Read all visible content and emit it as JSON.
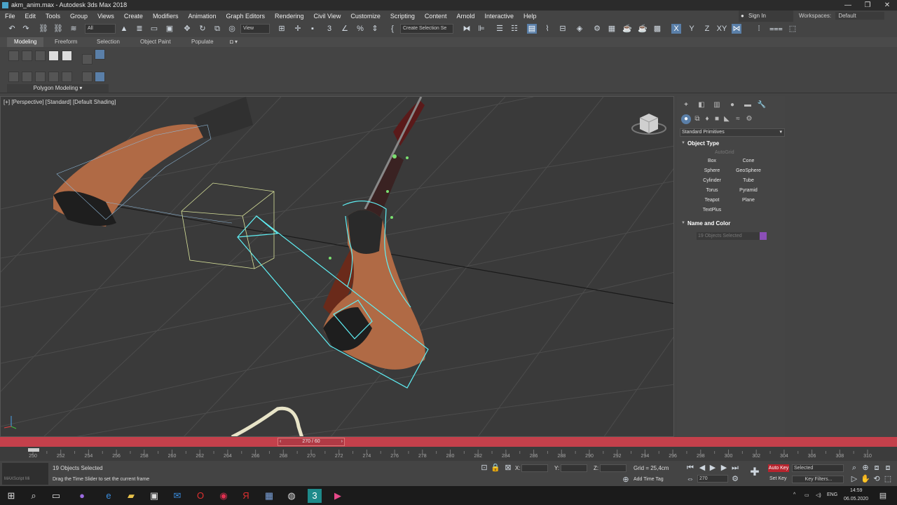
{
  "window": {
    "title": "akm_anim.max - Autodesk 3ds Max 2018",
    "controls": [
      "—",
      "❐",
      "✕"
    ]
  },
  "menu": [
    "File",
    "Edit",
    "Tools",
    "Group",
    "Views",
    "Create",
    "Modifiers",
    "Animation",
    "Graph Editors",
    "Rendering",
    "Civil View",
    "Customize",
    "Scripting",
    "Content",
    "Arnold",
    "Interactive",
    "Help"
  ],
  "signin": "Sign In",
  "workspace": {
    "label": "Workspaces:",
    "value": "Default"
  },
  "toolbar": {
    "selection_filter": "All",
    "ref_coord": "View",
    "named_selection": "Create Selection Se",
    "axis_labels": [
      "X",
      "Y",
      "Z",
      "XY"
    ]
  },
  "ribbon": {
    "tabs": [
      "Modeling",
      "Freeform",
      "Selection",
      "Object Paint",
      "Populate"
    ],
    "panel_label": "Polygon Modeling ▾"
  },
  "viewport": {
    "label": "[+] [Perspective] [Standard] [Default Shading]"
  },
  "command_panel": {
    "category": "Standard Primitives",
    "object_type_title": "Object Type",
    "autogrid": "AutoGrid",
    "primitives": [
      "Box",
      "Cone",
      "Sphere",
      "GeoSphere",
      "Cylinder",
      "Tube",
      "Torus",
      "Pyramid",
      "Teapot",
      "Plane",
      "TextPlus"
    ],
    "name_color_title": "Name and Color",
    "name_field": "19 Objects Selected",
    "object_color": "#8b4fb7"
  },
  "timeline": {
    "slider_label": "270 / 60",
    "current_frame": 270,
    "range_start": 250,
    "range_end": 310,
    "ticks": [
      "250",
      "252",
      "254",
      "256",
      "258",
      "260",
      "262",
      "264",
      "266",
      "268",
      "270",
      "272",
      "274",
      "276",
      "278",
      "280",
      "282",
      "284",
      "286",
      "288",
      "290",
      "292",
      "294",
      "296",
      "298",
      "300",
      "302",
      "304",
      "306",
      "308",
      "310"
    ]
  },
  "status": {
    "maxscript": "MAXScript Mi",
    "selected": "19 Objects Selected",
    "prompt": "Drag the Time Slider to set the current frame",
    "x_label": "X:",
    "y_label": "Y:",
    "z_label": "Z:",
    "grid": "Grid = 25,4cm",
    "add_time_tag": "Add Time Tag",
    "auto_key": "Auto Key",
    "set_key": "Set Key",
    "key_mode": "Selected",
    "key_filters": "Key Filters...",
    "frame_field": "270"
  },
  "taskbar": {
    "lang": "ENG",
    "time": "14:59",
    "date": "06.05.2020"
  }
}
